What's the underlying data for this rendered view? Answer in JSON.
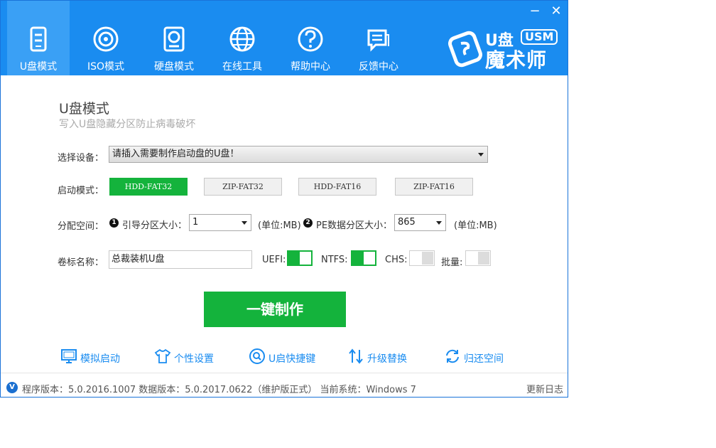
{
  "window": {
    "minimize": "−",
    "close": "✕"
  },
  "tabs": [
    {
      "label": "U盘模式",
      "icon": "usb-drive-icon",
      "active": true
    },
    {
      "label": "ISO模式",
      "icon": "disc-icon",
      "active": false
    },
    {
      "label": "硬盘模式",
      "icon": "hard-disk-icon",
      "active": false
    },
    {
      "label": "在线工具",
      "icon": "globe-icon",
      "active": false
    },
    {
      "label": "帮助中心",
      "icon": "help-icon",
      "active": false
    },
    {
      "label": "反馈中心",
      "icon": "chat-icon",
      "active": false
    }
  ],
  "logo": {
    "u": "U盘",
    "usm": "USM",
    "name": "魔术师"
  },
  "page": {
    "title": "U盘模式",
    "subtitle": "写入U盘隐藏分区防止病毒破坏"
  },
  "device": {
    "label": "选择设备：",
    "value": "请插入需要制作启动盘的U盘！"
  },
  "boot": {
    "label": "启动模式：",
    "modes": [
      {
        "label": "HDD-FAT32",
        "active": true
      },
      {
        "label": "ZIP-FAT32",
        "active": false
      },
      {
        "label": "HDD-FAT16",
        "active": false
      },
      {
        "label": "ZIP-FAT16",
        "active": false
      }
    ]
  },
  "space": {
    "label": "分配空间：",
    "boot_badge": "1",
    "boot_label": "引导分区大小：",
    "boot_value": "1",
    "unit1": "(单位:MB)",
    "pe_badge": "2",
    "pe_label": "PE数据分区大小：",
    "pe_value": "865",
    "unit2": "(单位:MB)"
  },
  "volume": {
    "label": "卷标名称：",
    "value": "总裁装机U盘",
    "toggles": [
      {
        "label": "UEFI:",
        "on": true
      },
      {
        "label": "NTFS:",
        "on": true
      },
      {
        "label": "CHS:",
        "on": false
      },
      {
        "label": "批量:",
        "on": false
      }
    ]
  },
  "make_button": "一键制作",
  "tools": [
    {
      "label": "模拟启动",
      "icon": "monitor-icon"
    },
    {
      "label": "个性设置",
      "icon": "tshirt-icon"
    },
    {
      "label": "U启快捷键",
      "icon": "search-icon"
    },
    {
      "label": "升级替换",
      "icon": "up-down-arrows-icon"
    },
    {
      "label": "归还空间",
      "icon": "refresh-icon"
    }
  ],
  "status": {
    "badge": "V",
    "text": "程序版本：5.0.2016.1007 数据版本：5.0.2017.0622（维护版正式） 当前系统：Windows 7",
    "changelog": "更新日志"
  },
  "colors": {
    "header": "#1a8cf0",
    "active_tab": "#3aa0f5",
    "green": "#14b33c",
    "link": "#1a8cf0"
  }
}
